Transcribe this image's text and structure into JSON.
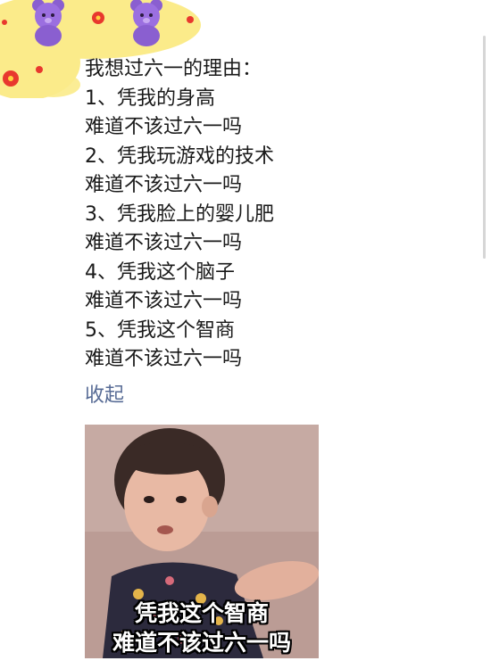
{
  "post": {
    "lines": [
      "我想过六一的理由：",
      "1、凭我的身高",
      "难道不该过六一吗",
      "2、凭我玩游戏的技术",
      "难道不该过六一吗",
      "3、凭我脸上的婴儿肥",
      "难道不该过六一吗",
      "4、凭我这个脑子",
      "难道不该过六一吗",
      "5、凭我这个智商",
      "难道不该过六一吗"
    ],
    "collapse_label": "收起"
  },
  "meme": {
    "caption_line1": "凭我这个智商",
    "caption_line2": "难道不该过六一吗",
    "icon": "child-photo"
  },
  "colors": {
    "text": "#1a1a1a",
    "link": "#576b95",
    "decoration_yellow": "#fbeb8a",
    "bear_purple": "#8a5fd0"
  }
}
